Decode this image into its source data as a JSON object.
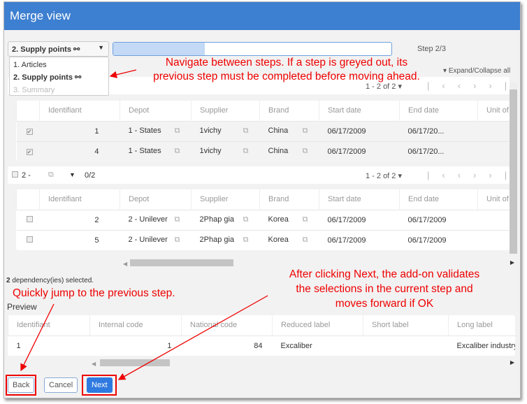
{
  "window": {
    "title": "Merge view"
  },
  "stepper": {
    "selected": "2. Supply points",
    "options": [
      {
        "label": "1. Articles",
        "state": "normal"
      },
      {
        "label": "2. Supply points",
        "state": "current"
      },
      {
        "label": "3. Summary",
        "state": "disabled"
      }
    ],
    "progress_percent": 33,
    "step_label": "Step 2/3",
    "expand_label": "Expand/Collapse all"
  },
  "columns": [
    "Identifiant",
    "Depot",
    "Supplier",
    "Brand",
    "Start date",
    "End date",
    "Unit of pr"
  ],
  "group1": {
    "pager": "1 - 2 of 2",
    "rows": [
      {
        "id": "1",
        "depot": "1 - States",
        "supplier": "1vichy",
        "brand": "China",
        "start": "06/17/2009",
        "end": "06/17/20...",
        "checked": true
      },
      {
        "id": "4",
        "depot": "1 - States",
        "supplier": "1vichy",
        "brand": "China",
        "start": "06/17/2009",
        "end": "06/17/20...",
        "checked": true
      }
    ]
  },
  "group2": {
    "name": "2 -",
    "count": "0/2",
    "pager": "1 - 2 of 2",
    "rows": [
      {
        "id": "2",
        "depot": "2 - Unilever",
        "supplier": "2Phap gia",
        "brand": "Korea",
        "start": "06/17/2009",
        "end": "06/17/2009",
        "checked": false
      },
      {
        "id": "5",
        "depot": "2 - Unilever",
        "supplier": "2Phap gia",
        "brand": "Korea",
        "start": "06/17/2009",
        "end": "06/17/2009",
        "checked": false
      }
    ]
  },
  "selection": {
    "count": "2",
    "text": " dependency(ies) selected."
  },
  "preview": {
    "label": "Preview",
    "columns": [
      "Identifiant",
      "Internal code",
      "National code",
      "Reduced label",
      "Short label",
      "Long label"
    ],
    "row": [
      "1",
      "1",
      "84",
      "Excaliber",
      "",
      "Excaliber industry"
    ]
  },
  "buttons": {
    "back": "Back",
    "cancel": "Cancel",
    "next": "Next"
  },
  "annotations": {
    "steps_line1": "Navigate between steps. If a step is greyed out, its",
    "steps_line2": "previous step must be completed before moving ahead.",
    "back": "Quickly jump to the previous step.",
    "next_line1": "After clicking Next, the add-on validates",
    "next_line2": "the selections in the current step and",
    "next_line3": "moves forward if OK"
  },
  "colors": {
    "title_bar": "#3d7fd0",
    "annotation": "#ee0000",
    "next_button": "#2f7ae0"
  }
}
